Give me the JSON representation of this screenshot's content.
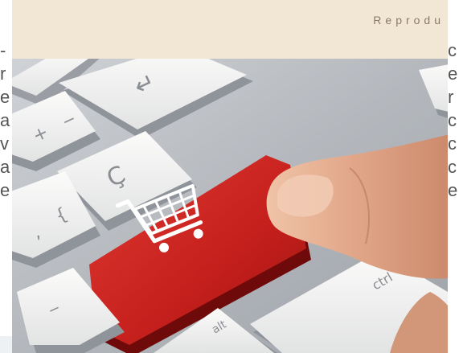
{
  "header": {
    "band_label": "Reprodu"
  },
  "left_column_fragments": [
    "-",
    "r",
    "e",
    "a",
    "v",
    "a",
    "e"
  ],
  "right_column_fragments": [
    "c",
    "e",
    "r",
    "c",
    "c",
    "c",
    "e"
  ],
  "photo": {
    "cart_key_label": "",
    "ctrl_key_label": "ctrl",
    "alt_key_label": "alt",
    "return_glyph": "↵",
    "key_glyph_c": "Ç",
    "key_glyph_plus": "+",
    "key_glyph_minus": "−",
    "key_glyph_brace": "{",
    "key_glyph_comma": ",",
    "colors": {
      "cart_key": "#c8201e",
      "key_face": "#f4f4f2",
      "keyboard_body": "#b9bcc0",
      "skin": "#e0a98c"
    }
  }
}
